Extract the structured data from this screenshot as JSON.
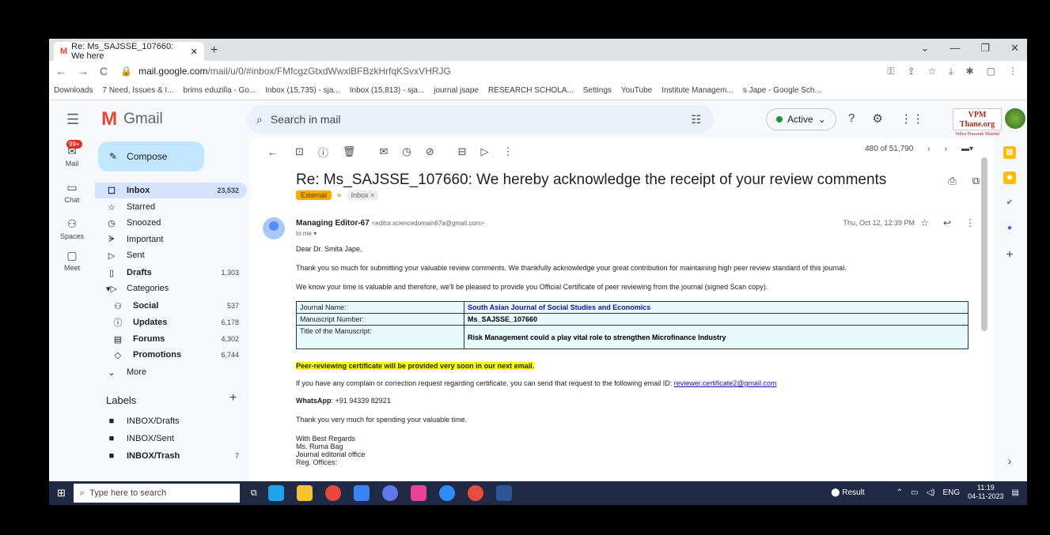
{
  "browser": {
    "tab_title": "Re: Ms_SAJSSE_107660: We here",
    "url_host": "mail.google.com",
    "url_path": "/mail/u/0/#inbox/FMfcgzGtxdWwxlBFBzkHrfqKSvxVHRJG",
    "bookmarks": [
      "Downloads",
      "7 Need, Issues & I...",
      "brims eduzilla - Go...",
      "Inbox (15,735) - sja...",
      "Inbox (15,813) - sja...",
      "journal jsape",
      "RESEARCH SCHOLA...",
      "Settings",
      "YouTube",
      "Institute Managem...",
      "s Jape - Google Sch..."
    ]
  },
  "header": {
    "app_name": "Gmail",
    "search_placeholder": "Search in mail",
    "status": "Active",
    "profile_logo_line1": "VPM Thane.org",
    "profile_logo_line2": "Vidya Prasarak Mandal"
  },
  "rail": {
    "badge": "99+",
    "items": [
      "Mail",
      "Chat",
      "Spaces",
      "Meet"
    ]
  },
  "sidebar": {
    "compose": "Compose",
    "items": [
      {
        "label": "Inbox",
        "count": "23,532"
      },
      {
        "label": "Starred",
        "count": ""
      },
      {
        "label": "Snoozed",
        "count": ""
      },
      {
        "label": "Important",
        "count": ""
      },
      {
        "label": "Sent",
        "count": ""
      },
      {
        "label": "Drafts",
        "count": "1,303"
      },
      {
        "label": "Categories",
        "count": ""
      },
      {
        "label": "Social",
        "count": "537"
      },
      {
        "label": "Updates",
        "count": "6,178"
      },
      {
        "label": "Forums",
        "count": "4,302"
      },
      {
        "label": "Promotions",
        "count": "6,744"
      },
      {
        "label": "More",
        "count": ""
      }
    ],
    "labels_title": "Labels",
    "labels": [
      {
        "label": "INBOX/Drafts",
        "count": ""
      },
      {
        "label": "INBOX/Sent",
        "count": ""
      },
      {
        "label": "INBOX/Trash",
        "count": "7"
      }
    ]
  },
  "message": {
    "pager": "480 of 51,790",
    "subject": "Re: Ms_SAJSSE_107660: We hereby acknowledge the receipt of your review comments",
    "chip_external": "External",
    "chip_inbox": "Inbox ×",
    "sender_name": "Managing Editor-67",
    "sender_email": "<editor.sciencedomain67a@gmail.com>",
    "to": "to me ▾",
    "date": "Thu, Oct 12, 12:39 PM",
    "greeting": "Dear Dr. Smita Jape,",
    "para1": "Thank you so much for submitting your valuable review comments. We thankfully acknowledge your great contribution for maintaining high peer review standard of this journal.",
    "para2": "We know your time is valuable and therefore, we'll be pleased to provide you Official Certificate of peer reviewing from the journal (signed Scan copy).",
    "table": [
      {
        "k": "Journal Name:",
        "v": "South Asian Journal of Social Studies and Economics"
      },
      {
        "k": "Manuscript Number:",
        "v": "Ms_SAJSSE_107660"
      },
      {
        "k": "Title of the Manuscript:",
        "v": "Risk Management could a play vital role to strengthen Microfinance Industry"
      }
    ],
    "highlight": "Peer-reviewing certificate will be provided very soon in our next email.",
    "para3": "If you have any complain or correction request regarding certificate, you can send that request to the following email ID: ",
    "email_link": "reviewer.certificate2@gmail.com",
    "whatsapp_label": "WhatsApp",
    "whatsapp_number": ": +91 94339 82921",
    "thanks": "Thank you very much for spending your valuable time.",
    "sign1": "With Best Regards",
    "sign2": "Ms. Ruma Bag",
    "sign3": "Journal editorial office",
    "sign4": "Reg. Offices:"
  },
  "taskbar": {
    "search": "Type here to search",
    "result": "Result",
    "lang": "ENG",
    "time": "11:19",
    "date": "04-11-2023"
  },
  "colors": {
    "accent": "#0b57d0",
    "inbox_sel": "#d3e3fd",
    "compose": "#c2e7ff",
    "table_bg": "#e6f9fb",
    "taskbar": "#202a44"
  }
}
